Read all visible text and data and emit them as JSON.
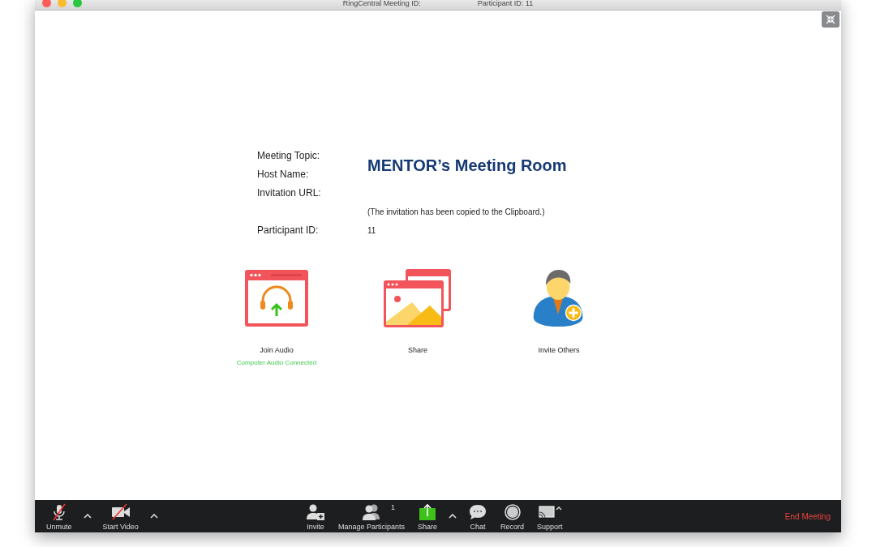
{
  "window": {
    "title_left": "RingCentral Meeting ID:",
    "title_right": "Participant ID: 11"
  },
  "meeting_info": {
    "labels": [
      "Meeting Topic:",
      "Host Name:",
      "Invitation URL:",
      "Participant ID:"
    ],
    "topic": "MENTOR’s Meeting Room",
    "invitation_note": "(The invitation has been copied to the Clipboard.)",
    "participant_id": "11"
  },
  "actions": [
    {
      "kind": "audio",
      "label": "Join Audio",
      "status": "Computer Audio Connected"
    },
    {
      "kind": "share",
      "label": "Share"
    },
    {
      "kind": "invite",
      "label": "Invite Others"
    }
  ],
  "toolbar": {
    "left": [
      {
        "kind": "mic",
        "label": "Unmute",
        "has_menu": true
      },
      {
        "kind": "video",
        "label": "Start Video",
        "has_menu": true
      }
    ],
    "center": [
      {
        "kind": "invite",
        "label": "Invite",
        "has_menu": false
      },
      {
        "kind": "participants",
        "label": "Manage Participants",
        "count": "1",
        "has_menu": false
      },
      {
        "kind": "share",
        "label": "Share",
        "has_menu": true
      },
      {
        "kind": "chat",
        "label": "Chat",
        "has_menu": false
      },
      {
        "kind": "record",
        "label": "Record",
        "has_menu": false
      },
      {
        "kind": "support",
        "label": "Support",
        "has_menu": false,
        "icon_caret": true
      }
    ],
    "end_button": "End Meeting"
  }
}
